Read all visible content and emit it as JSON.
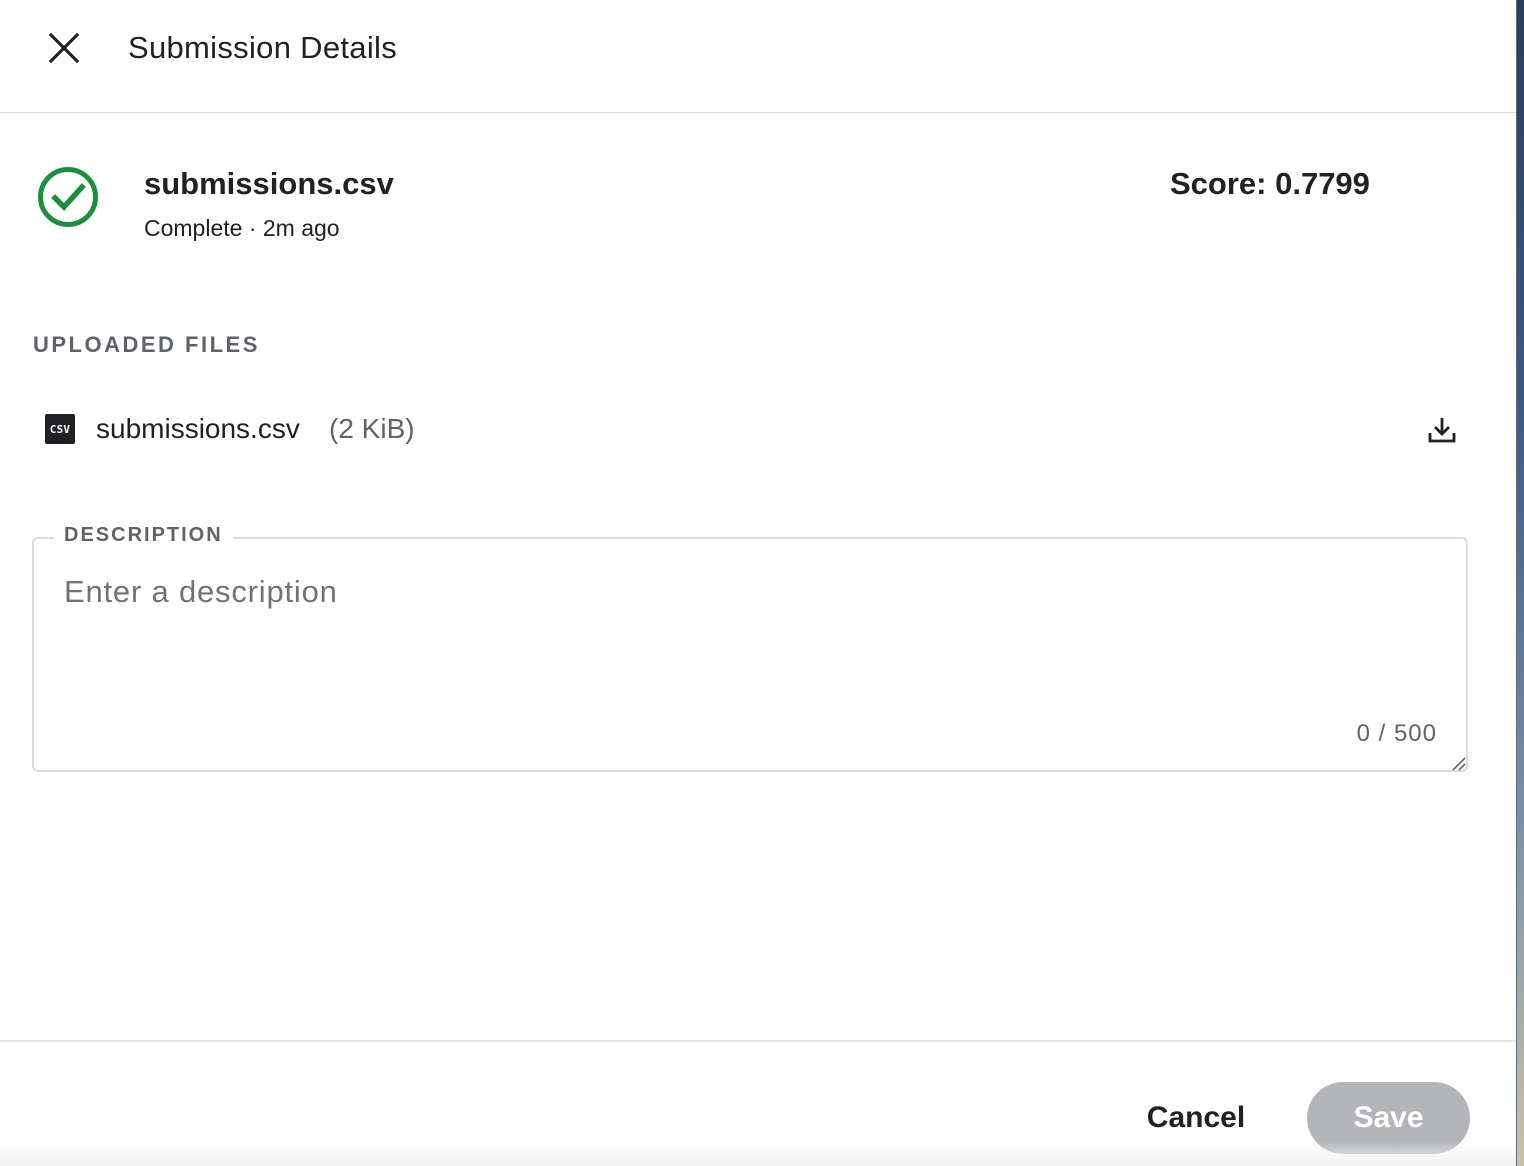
{
  "header": {
    "title": "Submission Details",
    "close_icon": "close-icon"
  },
  "submission": {
    "filename": "submissions.csv",
    "status": "Complete",
    "time_ago": "2m ago",
    "status_line": "Complete · 2m ago",
    "score_text": "Score: 0.7799",
    "status_icon": "check-circle-icon",
    "status_color": "#1e8e3e"
  },
  "uploaded_files": {
    "label": "UPLOADED FILES",
    "files": [
      {
        "icon_text": "CSV",
        "name": "submissions.csv",
        "size": "(2 KiB)",
        "download_icon": "download-icon"
      }
    ]
  },
  "description": {
    "label": "DESCRIPTION",
    "value": "",
    "placeholder": "Enter a description",
    "char_count": "0 / 500"
  },
  "footer": {
    "cancel_label": "Cancel",
    "save_label": "Save",
    "save_disabled": true
  },
  "colors": {
    "success": "#1e8e3e",
    "text_primary": "#202124",
    "text_secondary": "#5f6368",
    "divider": "#dadce0",
    "disabled_button": "#b3b5b8"
  }
}
